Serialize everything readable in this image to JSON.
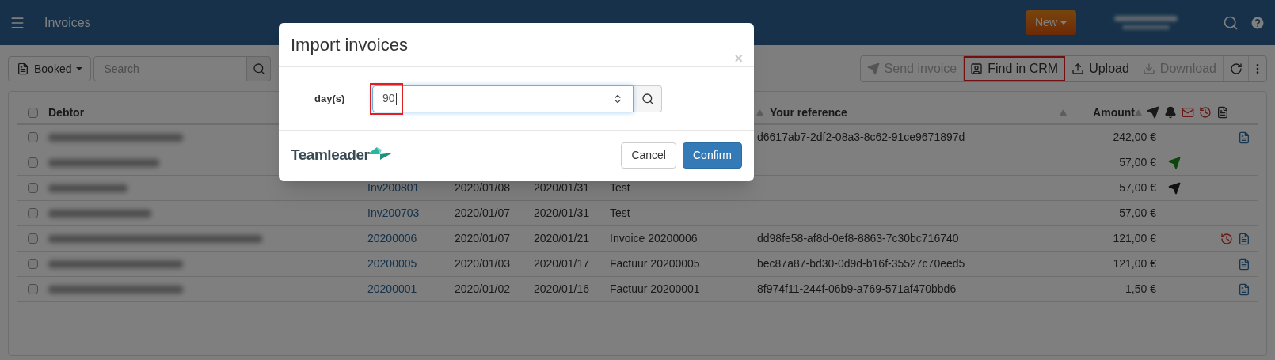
{
  "header": {
    "title": "Invoices",
    "new_button": "New"
  },
  "toolbar": {
    "filter": "Booked",
    "search": {
      "placeholder": "Search"
    },
    "actions": [
      {
        "kind": "send",
        "label": "Send invoice",
        "disabled": true,
        "highlighted": false
      },
      {
        "kind": "crm",
        "label": "Find in CRM",
        "disabled": false,
        "highlighted": true
      },
      {
        "kind": "upload",
        "label": "Upload",
        "disabled": false,
        "highlighted": false
      },
      {
        "kind": "download",
        "label": "Download",
        "disabled": true,
        "highlighted": false
      }
    ]
  },
  "table": {
    "columns": [
      "Debtor",
      "Your reference",
      "Amount"
    ],
    "all_checked": false,
    "rows": [
      {
        "checked": false,
        "reference": "d6617ab7-2df2-08a3-8c62-91ce9671897d",
        "amount": "242,00 €",
        "icons": [
          {
            "kind": "pdf"
          }
        ]
      },
      {
        "checked": false,
        "amount": "57,00 €",
        "icons": [
          {
            "kind": "sent"
          }
        ]
      },
      {
        "checked": false,
        "number": "Inv200801",
        "date": "2020/01/08",
        "due_date": "2020/01/31",
        "description": "Test",
        "amount": "57,00 €",
        "icons": [
          {
            "kind": "send"
          }
        ]
      },
      {
        "checked": false,
        "number": "Inv200703",
        "date": "2020/01/07",
        "due_date": "2020/01/31",
        "description": "Test",
        "amount": "57,00 €"
      },
      {
        "checked": false,
        "number": "20200006",
        "date": "2020/01/07",
        "due_date": "2020/01/21",
        "description": "Invoice 20200006",
        "reference": "dd98fe58-af8d-0ef8-8863-7c30bc716740",
        "amount": "121,00 €",
        "icons": [
          {
            "kind": "reminder"
          },
          {
            "kind": "pdf"
          }
        ]
      },
      {
        "checked": false,
        "number": "20200005",
        "date": "2020/01/03",
        "due_date": "2020/01/17",
        "description": "Factuur 20200005",
        "reference": "bec87a87-bd30-0d9d-b16f-35527c70eed5",
        "amount": "121,00 €",
        "icons": [
          {
            "kind": "pdf"
          }
        ]
      },
      {
        "checked": false,
        "number": "20200001",
        "date": "2020/01/02",
        "due_date": "2020/01/16",
        "description": "Factuur 20200001",
        "reference": "8f974f11-244f-06b9-a769-571af470bbd6",
        "amount": "1,50 €",
        "icons": [
          {
            "kind": "pdf"
          }
        ]
      }
    ]
  },
  "modal": {
    "title": "Import invoices",
    "close": "×",
    "field": {
      "label": "day(s)",
      "value": "90",
      "highlighted": true
    },
    "logo": "Teamleader",
    "buttons": [
      "Cancel",
      "Confirm"
    ]
  }
}
